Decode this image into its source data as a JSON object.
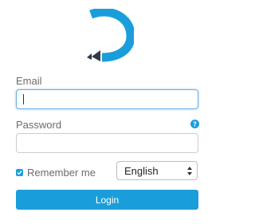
{
  "brand": {
    "logo_icon": "marker-pen-logo-icon",
    "colors": {
      "accent": "#1a9edb",
      "dark": "#2f3b46",
      "focus_border": "#66afe9"
    }
  },
  "login_form": {
    "email": {
      "label": "Email",
      "value": "",
      "placeholder": ""
    },
    "password": {
      "label": "Password",
      "value": "",
      "placeholder": "",
      "help_icon": "question-circle-icon"
    },
    "remember_me": {
      "label": "Remember me",
      "checked": true
    },
    "language": {
      "selected": "English"
    },
    "submit_label": "Login"
  }
}
